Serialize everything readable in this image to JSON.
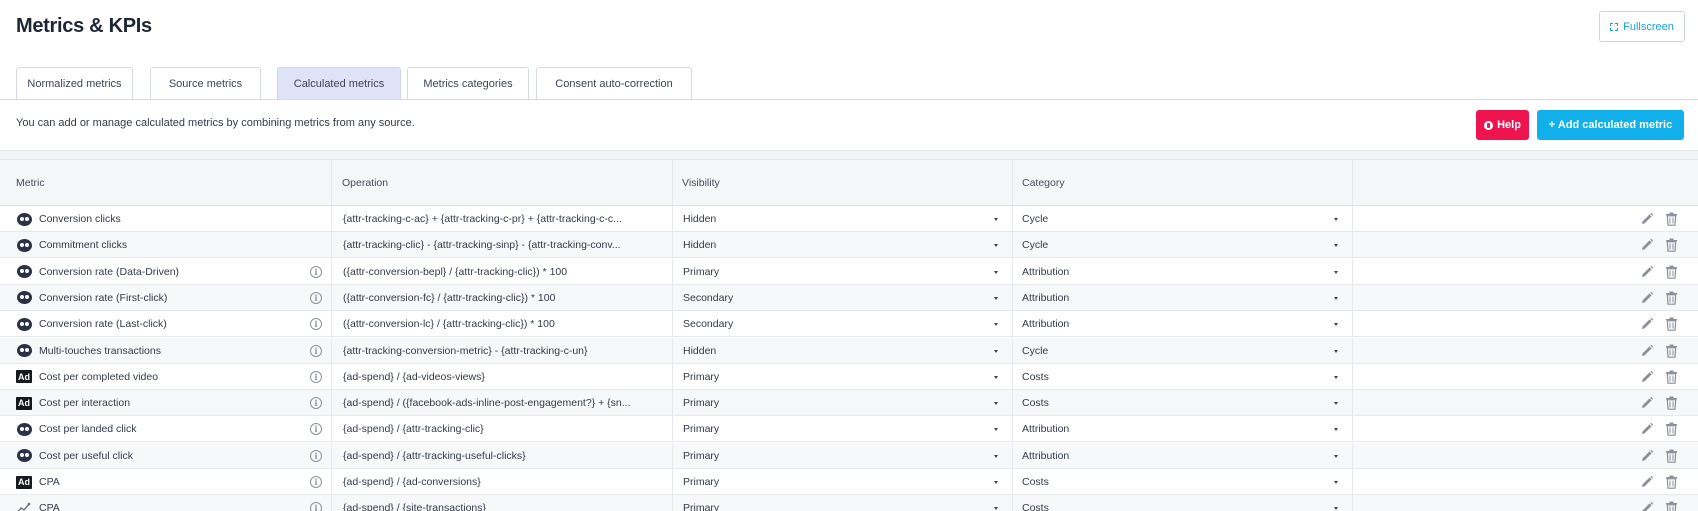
{
  "page": {
    "title": "Metrics & KPIs",
    "fullscreen_label": "Fullscreen"
  },
  "tabs": [
    {
      "label": "Normalized metrics",
      "active": false
    },
    {
      "label": "Source metrics",
      "active": false
    },
    {
      "label": "Calculated metrics",
      "active": true
    },
    {
      "label": "Metrics categories",
      "active": false
    },
    {
      "label": "Consent auto-correction",
      "active": false
    }
  ],
  "info_bar": {
    "text": "You can add or manage calculated metrics by combining metrics from any source.",
    "help_label": "Help",
    "add_label": "+ Add calculated metric"
  },
  "colors": {
    "help": "#ee1450",
    "add": "#12b0ea",
    "active_tab": "#dfe3f7"
  },
  "table": {
    "headers": [
      "Metric",
      "Operation",
      "Visibility",
      "Category"
    ],
    "rows": [
      {
        "icon": "attribution-icon",
        "metric": "Conversion clicks",
        "info": false,
        "operation": "{attr-tracking-c-ac} + {attr-tracking-c-pr} + {attr-tracking-c-c...",
        "visibility": "Hidden",
        "category": "Cycle"
      },
      {
        "icon": "attribution-icon",
        "metric": "Commitment clicks",
        "info": false,
        "operation": "{attr-tracking-clic} - {attr-tracking-sinp} - {attr-tracking-conv...",
        "visibility": "Hidden",
        "category": "Cycle"
      },
      {
        "icon": "attribution-icon",
        "metric": "Conversion rate (Data-Driven)",
        "info": true,
        "operation": "({attr-conversion-bepl} / {attr-tracking-clic}) * 100",
        "visibility": "Primary",
        "category": "Attribution"
      },
      {
        "icon": "attribution-icon",
        "metric": "Conversion rate (First-click)",
        "info": true,
        "operation": "({attr-conversion-fc} / {attr-tracking-clic}) * 100",
        "visibility": "Secondary",
        "category": "Attribution"
      },
      {
        "icon": "attribution-icon",
        "metric": "Conversion rate (Last-click)",
        "info": true,
        "operation": "({attr-conversion-lc} / {attr-tracking-clic}) * 100",
        "visibility": "Secondary",
        "category": "Attribution"
      },
      {
        "icon": "attribution-icon",
        "metric": "Multi-touches transactions",
        "info": true,
        "operation": "{attr-tracking-conversion-metric} - {attr-tracking-c-un}",
        "visibility": "Hidden",
        "category": "Cycle"
      },
      {
        "icon": "ad-icon",
        "metric": "Cost per completed video",
        "info": true,
        "operation": "{ad-spend} / {ad-videos-views}",
        "visibility": "Primary",
        "category": "Costs"
      },
      {
        "icon": "ad-icon",
        "metric": "Cost per interaction",
        "info": true,
        "operation": "{ad-spend} / ({facebook-ads-inline-post-engagement?} + {sn...",
        "visibility": "Primary",
        "category": "Costs"
      },
      {
        "icon": "attribution-icon",
        "metric": "Cost per landed click",
        "info": true,
        "operation": "{ad-spend} / {attr-tracking-clic}",
        "visibility": "Primary",
        "category": "Attribution"
      },
      {
        "icon": "attribution-icon",
        "metric": "Cost per useful click",
        "info": true,
        "operation": "{ad-spend} / {attr-tracking-useful-clicks}",
        "visibility": "Primary",
        "category": "Attribution"
      },
      {
        "icon": "ad-icon",
        "metric": "CPA",
        "info": true,
        "operation": "{ad-spend} / {ad-conversions}",
        "visibility": "Primary",
        "category": "Costs"
      },
      {
        "icon": "site-icon",
        "metric": "CPA",
        "info": true,
        "operation": "{ad-spend} / {site-transactions}",
        "visibility": "Primary",
        "category": "Costs"
      }
    ]
  }
}
